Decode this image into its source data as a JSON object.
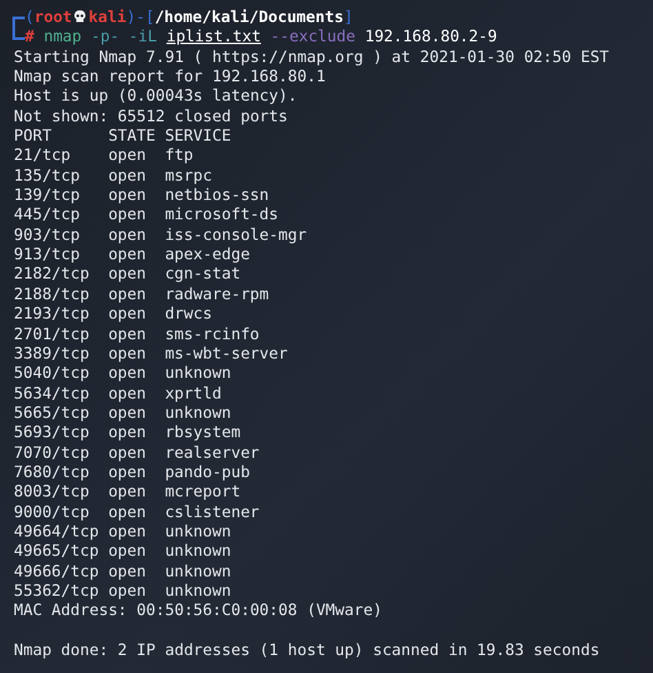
{
  "prompt": {
    "open": "(",
    "user": "root",
    "host": "kali",
    "sep": ")-[",
    "cwd": "/home/kali/Documents",
    "close": "]",
    "symbol": "#"
  },
  "command": [
    {
      "kind": "command",
      "text": "nmap"
    },
    {
      "kind": "option",
      "text": "-p-"
    },
    {
      "kind": "option",
      "text": "-iL"
    },
    {
      "kind": "path",
      "text": "iplist.txt"
    },
    {
      "kind": "long-option",
      "text": "--exclude"
    },
    {
      "kind": "argument",
      "text": "192.168.80.2-9"
    }
  ],
  "header_lines": [
    "Starting Nmap 7.91 ( https://nmap.org ) at 2021-01-30 02:50 EST",
    "Nmap scan report for 192.168.80.1",
    "Host is up (0.00043s latency).",
    "Not shown: 65512 closed ports"
  ],
  "columns": [
    "PORT",
    "STATE",
    "SERVICE"
  ],
  "ports": [
    {
      "port": "21/tcp",
      "state": "open",
      "service": "ftp"
    },
    {
      "port": "135/tcp",
      "state": "open",
      "service": "msrpc"
    },
    {
      "port": "139/tcp",
      "state": "open",
      "service": "netbios-ssn"
    },
    {
      "port": "445/tcp",
      "state": "open",
      "service": "microsoft-ds"
    },
    {
      "port": "903/tcp",
      "state": "open",
      "service": "iss-console-mgr"
    },
    {
      "port": "913/tcp",
      "state": "open",
      "service": "apex-edge"
    },
    {
      "port": "2182/tcp",
      "state": "open",
      "service": "cgn-stat"
    },
    {
      "port": "2188/tcp",
      "state": "open",
      "service": "radware-rpm"
    },
    {
      "port": "2193/tcp",
      "state": "open",
      "service": "drwcs"
    },
    {
      "port": "2701/tcp",
      "state": "open",
      "service": "sms-rcinfo"
    },
    {
      "port": "3389/tcp",
      "state": "open",
      "service": "ms-wbt-server"
    },
    {
      "port": "5040/tcp",
      "state": "open",
      "service": "unknown"
    },
    {
      "port": "5634/tcp",
      "state": "open",
      "service": "xprtld"
    },
    {
      "port": "5665/tcp",
      "state": "open",
      "service": "unknown"
    },
    {
      "port": "5693/tcp",
      "state": "open",
      "service": "rbsystem"
    },
    {
      "port": "7070/tcp",
      "state": "open",
      "service": "realserver"
    },
    {
      "port": "7680/tcp",
      "state": "open",
      "service": "pando-pub"
    },
    {
      "port": "8003/tcp",
      "state": "open",
      "service": "mcreport"
    },
    {
      "port": "9000/tcp",
      "state": "open",
      "service": "cslistener"
    },
    {
      "port": "49664/tcp",
      "state": "open",
      "service": "unknown"
    },
    {
      "port": "49665/tcp",
      "state": "open",
      "service": "unknown"
    },
    {
      "port": "49666/tcp",
      "state": "open",
      "service": "unknown"
    },
    {
      "port": "55362/tcp",
      "state": "open",
      "service": "unknown"
    }
  ],
  "mac_line": "MAC Address: 00:50:56:C0:00:08 (VMware)",
  "done_line": "Nmap done: 2 IP addresses (1 host up) scanned in 19.83 seconds"
}
